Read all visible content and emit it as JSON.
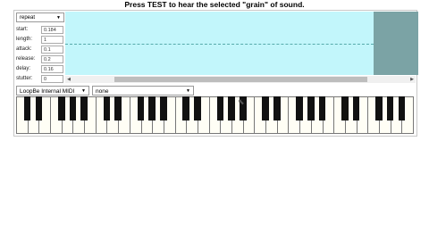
{
  "header": {
    "title": "Press TEST to hear the selected \"grain\" of sound."
  },
  "controls": {
    "mode": "repeat",
    "params": [
      {
        "label": "start:",
        "value": "0.184"
      },
      {
        "label": "length:",
        "value": "1"
      },
      {
        "label": "attack:",
        "value": "0.1"
      },
      {
        "label": "release:",
        "value": "0.2"
      },
      {
        "label": "delay:",
        "value": "0.16"
      },
      {
        "label": "stutter:",
        "value": "0"
      }
    ]
  },
  "midi": {
    "input": "LoopBe Internal MIDI",
    "output": "none"
  },
  "colors": {
    "waveform_bg": "#c2f6fb",
    "selection": "#7ba3a5",
    "record": "#cc3333"
  },
  "icons": {
    "record": "record-dot-icon",
    "caret": "chevron-down-icon",
    "scroll_left": "arrow-left-icon",
    "scroll_right": "arrow-right-icon",
    "cursor": "mouse-pointer-icon"
  }
}
